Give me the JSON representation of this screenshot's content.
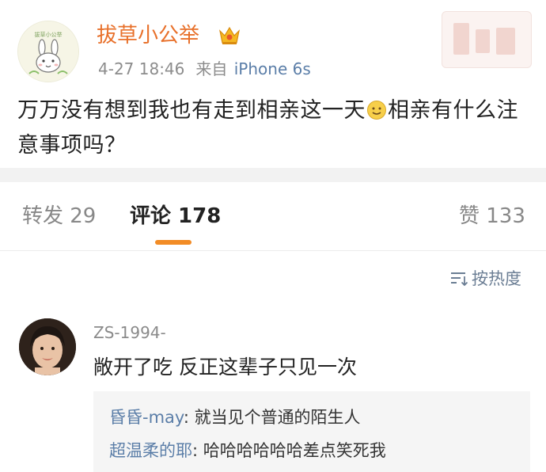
{
  "post": {
    "username": "拔草小公举",
    "avatar_text": "拔草小公举",
    "date": "4-27 18:46",
    "source_prefix": "来自",
    "source_device": "iPhone 6s",
    "text_part1": "万万没有想到我也有走到相亲这一天",
    "text_part2": "相亲有什么注意事项吗？"
  },
  "tabs": [
    {
      "label": "转发 29"
    },
    {
      "label": "评论 178"
    },
    {
      "label": "赞 133"
    }
  ],
  "sort": {
    "label": "按热度"
  },
  "comment": {
    "username": "ZS-1994-",
    "text": "敞开了吃 反正这辈子只见一次",
    "replies": [
      {
        "user": "昏昏-may",
        "text": ": 就当见个普通的陌生人"
      },
      {
        "user": "超温柔的耶",
        "text": ": 哈哈哈哈哈哈差点笑死我"
      }
    ]
  },
  "colors": {
    "username": "#e8702a",
    "link": "#5b7ea8",
    "tab_indicator": "#f28c26"
  }
}
